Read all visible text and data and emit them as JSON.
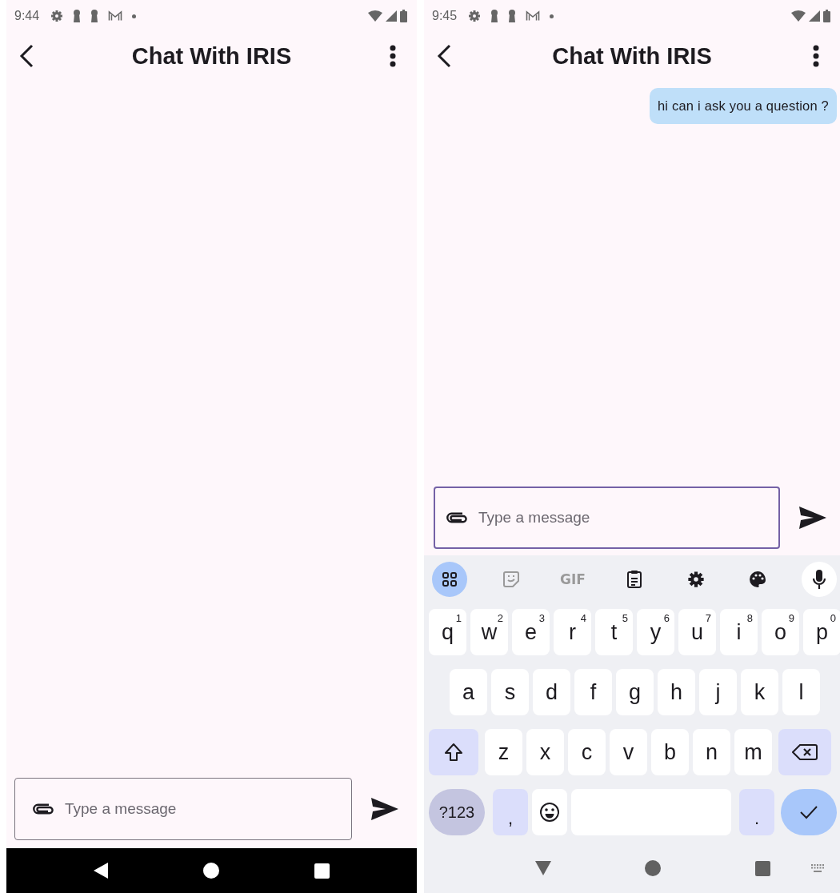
{
  "screens": [
    {
      "status_bar": {
        "time": "9:44"
      },
      "app_bar": {
        "title": "Chat With IRIS"
      },
      "composer": {
        "placeholder": "Type a message",
        "focused": false
      },
      "nav_bar": {
        "kind": "dark"
      }
    },
    {
      "status_bar": {
        "time": "9:45"
      },
      "app_bar": {
        "title": "Chat With IRIS"
      },
      "messages": [
        {
          "text": "hi can i ask you a question ?"
        }
      ],
      "composer": {
        "placeholder": "Type a message",
        "focused": true
      },
      "keyboard": {
        "toolbar": [
          {
            "kind": "apps",
            "selected": true
          },
          {
            "kind": "sticker",
            "selected": false
          },
          {
            "kind": "gif",
            "label": "GIF",
            "selected": false
          },
          {
            "kind": "clipboard",
            "selected": false
          },
          {
            "kind": "settings",
            "selected": false
          },
          {
            "kind": "palette",
            "selected": false
          },
          {
            "kind": "mic",
            "selected": false
          }
        ],
        "rows": [
          {
            "keys": [
              {
                "kind": "letter",
                "label": "q",
                "hint": "1"
              },
              {
                "kind": "letter",
                "label": "w",
                "hint": "2"
              },
              {
                "kind": "letter",
                "label": "e",
                "hint": "3"
              },
              {
                "kind": "letter",
                "label": "r",
                "hint": "4"
              },
              {
                "kind": "letter",
                "label": "t",
                "hint": "5"
              },
              {
                "kind": "letter",
                "label": "y",
                "hint": "6"
              },
              {
                "kind": "letter",
                "label": "u",
                "hint": "7"
              },
              {
                "kind": "letter",
                "label": "i",
                "hint": "8"
              },
              {
                "kind": "letter",
                "label": "o",
                "hint": "9"
              },
              {
                "kind": "letter",
                "label": "p",
                "hint": "0"
              }
            ]
          },
          {
            "keys": [
              {
                "kind": "letter",
                "label": "a"
              },
              {
                "kind": "letter",
                "label": "s"
              },
              {
                "kind": "letter",
                "label": "d"
              },
              {
                "kind": "letter",
                "label": "f"
              },
              {
                "kind": "letter",
                "label": "g"
              },
              {
                "kind": "letter",
                "label": "h"
              },
              {
                "kind": "letter",
                "label": "j"
              },
              {
                "kind": "letter",
                "label": "k"
              },
              {
                "kind": "letter",
                "label": "l"
              }
            ]
          },
          {
            "keys": [
              {
                "kind": "shift"
              },
              {
                "kind": "letter",
                "label": "z"
              },
              {
                "kind": "letter",
                "label": "x"
              },
              {
                "kind": "letter",
                "label": "c"
              },
              {
                "kind": "letter",
                "label": "v"
              },
              {
                "kind": "letter",
                "label": "b"
              },
              {
                "kind": "letter",
                "label": "n"
              },
              {
                "kind": "letter",
                "label": "m"
              },
              {
                "kind": "backspace"
              }
            ]
          },
          {
            "keys": [
              {
                "kind": "symbols",
                "label": "?123"
              },
              {
                "kind": "punct",
                "label": ","
              },
              {
                "kind": "emoji"
              },
              {
                "kind": "space"
              },
              {
                "kind": "punct",
                "label": "."
              },
              {
                "kind": "enter"
              }
            ]
          }
        ]
      },
      "nav_bar": {
        "kind": "keyboard"
      }
    }
  ]
}
